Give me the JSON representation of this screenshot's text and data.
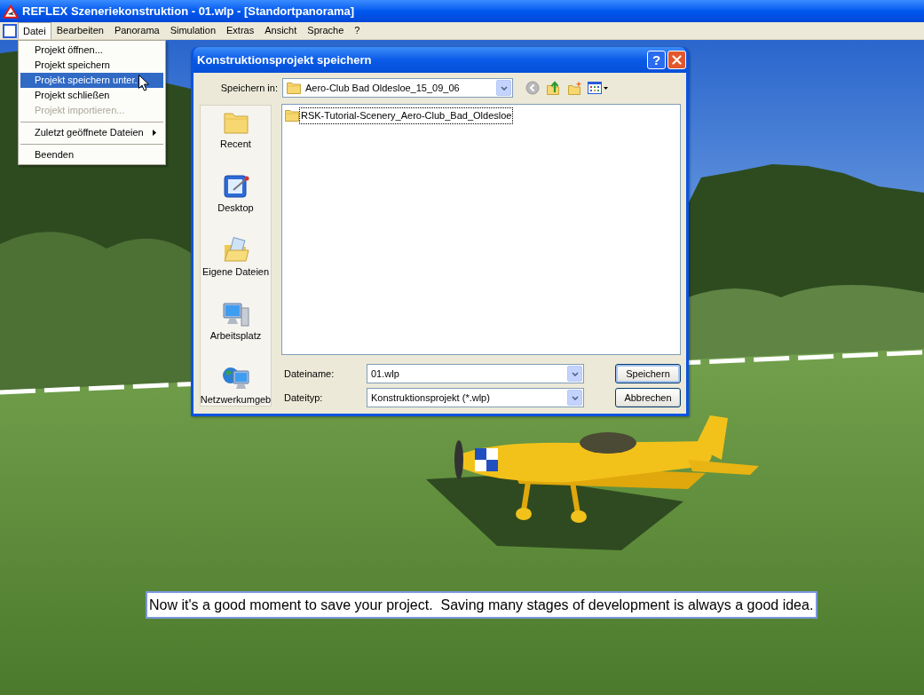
{
  "window": {
    "title": "REFLEX Szeneriekonstruktion - 01.wlp - [Standortpanorama]"
  },
  "menu_bar": [
    {
      "label": "Datei",
      "selected": true
    },
    {
      "label": "Bearbeiten",
      "selected": false
    },
    {
      "label": "Panorama",
      "selected": false
    },
    {
      "label": "Simulation",
      "selected": false
    },
    {
      "label": "Extras",
      "selected": false
    },
    {
      "label": "Ansicht",
      "selected": false
    },
    {
      "label": "Sprache",
      "selected": false
    },
    {
      "label": "?",
      "selected": false
    }
  ],
  "file_menu": [
    {
      "kind": "item",
      "label": "Projekt öffnen...",
      "selected": false,
      "disabled": false
    },
    {
      "kind": "item",
      "label": "Projekt speichern",
      "selected": false,
      "disabled": false
    },
    {
      "kind": "item",
      "label": "Projekt speichern unter.",
      "selected": true,
      "disabled": false
    },
    {
      "kind": "item",
      "label": "Projekt schließen",
      "selected": false,
      "disabled": false
    },
    {
      "kind": "item",
      "label": "Projekt importieren...",
      "selected": false,
      "disabled": true
    },
    {
      "kind": "separator"
    },
    {
      "kind": "submenu",
      "label": "Zuletzt geöffnete Dateien",
      "selected": false,
      "disabled": false
    },
    {
      "kind": "separator"
    },
    {
      "kind": "item",
      "label": "Beenden",
      "selected": false,
      "disabled": false
    }
  ],
  "save_dialog": {
    "title": "Konstruktionsprojekt speichern",
    "help_label": "?",
    "look_in": {
      "label": "Speichern in:",
      "value": "Aero-Club Bad Oldesloe_15_09_06"
    },
    "places": [
      {
        "kind": "recent",
        "label": "Recent"
      },
      {
        "kind": "desktop",
        "label": "Desktop"
      },
      {
        "kind": "documents",
        "label": "Eigene Dateien"
      },
      {
        "kind": "computer",
        "label": "Arbeitsplatz"
      },
      {
        "kind": "network",
        "label": "Netzwerkumgeb"
      }
    ],
    "files": [
      {
        "name": "RSK-Tutorial-Scenery_Aero-Club_Bad_Oldesloe",
        "focused": true
      }
    ],
    "file_name": {
      "label": "Dateiname:",
      "value": "01.wlp"
    },
    "file_type": {
      "label": "Dateityp:",
      "value": "Konstruktionsprojekt (*.wlp)"
    },
    "buttons": [
      {
        "label": "Speichern",
        "default": true
      },
      {
        "label": "Abbrechen",
        "default": false
      }
    ]
  },
  "hint": "Now it's a good moment to save your project.  Saving many stages of development is always a good idea."
}
